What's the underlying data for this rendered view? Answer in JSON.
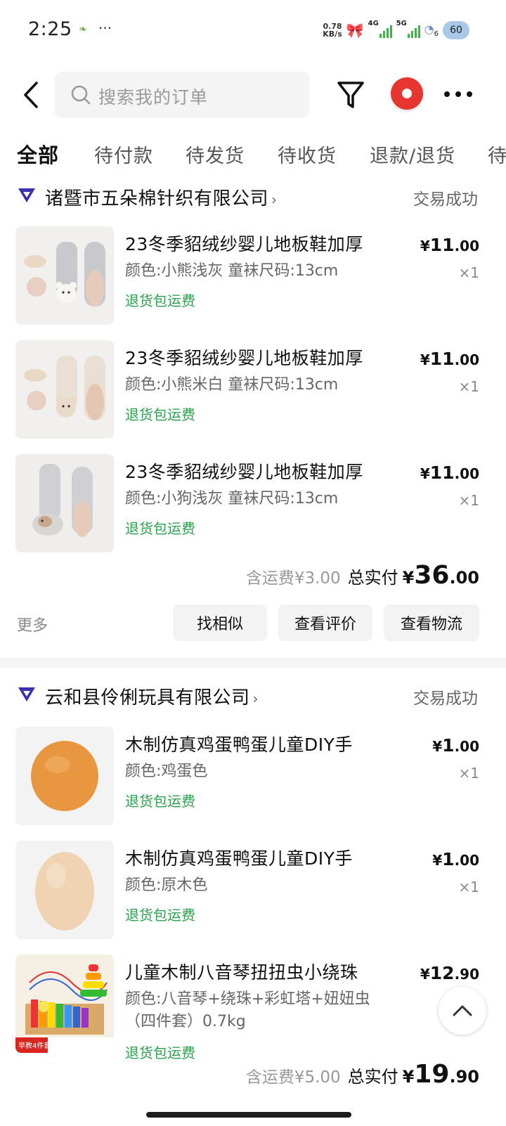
{
  "status_bar": {
    "time": "2:25",
    "dots": "···",
    "net_speed_value": "0.78",
    "net_speed_unit": "KB/s",
    "signal1": "4G",
    "signal2": "5G",
    "wifi_count": "6",
    "battery": "60"
  },
  "header": {
    "search_placeholder": "搜索我的订单"
  },
  "tabs": [
    "全部",
    "待付款",
    "待发货",
    "待收货",
    "退款/退货",
    "待"
  ],
  "orders": [
    {
      "shop": "诸暨市五朵棉针织有限公司",
      "status": "交易成功",
      "items": [
        {
          "title": "23冬季貂绒纱婴儿地板鞋加厚",
          "spec": "颜色:小熊浅灰 童袜尺码:13cm",
          "tag": "退货包运费",
          "price_cur": "¥",
          "price_int": "11",
          "price_dec": ".00",
          "qty": "×1"
        },
        {
          "title": "23冬季貂绒纱婴儿地板鞋加厚",
          "spec": "颜色:小熊米白 童袜尺码:13cm",
          "tag": "退货包运费",
          "price_cur": "¥",
          "price_int": "11",
          "price_dec": ".00",
          "qty": "×1"
        },
        {
          "title": "23冬季貂绒纱婴儿地板鞋加厚",
          "spec": "颜色:小狗浅灰 童袜尺码:13cm",
          "tag": "退货包运费",
          "price_cur": "¥",
          "price_int": "11",
          "price_dec": ".00",
          "qty": "×1"
        }
      ],
      "shipping": "含运费¥3.00",
      "total_label": "总实付",
      "total_cur": "¥",
      "total_int": "36",
      "total_dec": ".00",
      "more": "更多",
      "actions": [
        "找相似",
        "查看评价",
        "查看物流"
      ]
    },
    {
      "shop": "云和县伶俐玩具有限公司",
      "status": "交易成功",
      "items": [
        {
          "title": "木制仿真鸡蛋鸭蛋儿童DIY手",
          "spec": "颜色:鸡蛋色",
          "tag": "退货包运费",
          "price_cur": "¥",
          "price_int": "1",
          "price_dec": ".00",
          "qty": "×1"
        },
        {
          "title": "木制仿真鸡蛋鸭蛋儿童DIY手",
          "spec": "颜色:原木色",
          "tag": "退货包运费",
          "price_cur": "¥",
          "price_int": "1",
          "price_dec": ".00",
          "qty": "×1"
        },
        {
          "title": "儿童木制八音琴扭扭虫小绕珠",
          "spec": "颜色:八音琴+绕珠+彩虹塔+妞妞虫（四件套）0.7kg",
          "tag": "退货包运费",
          "price_cur": "¥",
          "price_int": "12",
          "price_dec": ".90",
          "qty": "×1",
          "thumb_label": "早教4件套"
        }
      ],
      "shipping": "含运费¥5.00",
      "total_label": "总实付",
      "total_cur": "¥",
      "total_int": "19",
      "total_dec": ".90"
    }
  ],
  "colors": {
    "accent_green": "#2ba24c",
    "badge_red": "#e7362f",
    "shop_logo": "#3a2fb0"
  }
}
